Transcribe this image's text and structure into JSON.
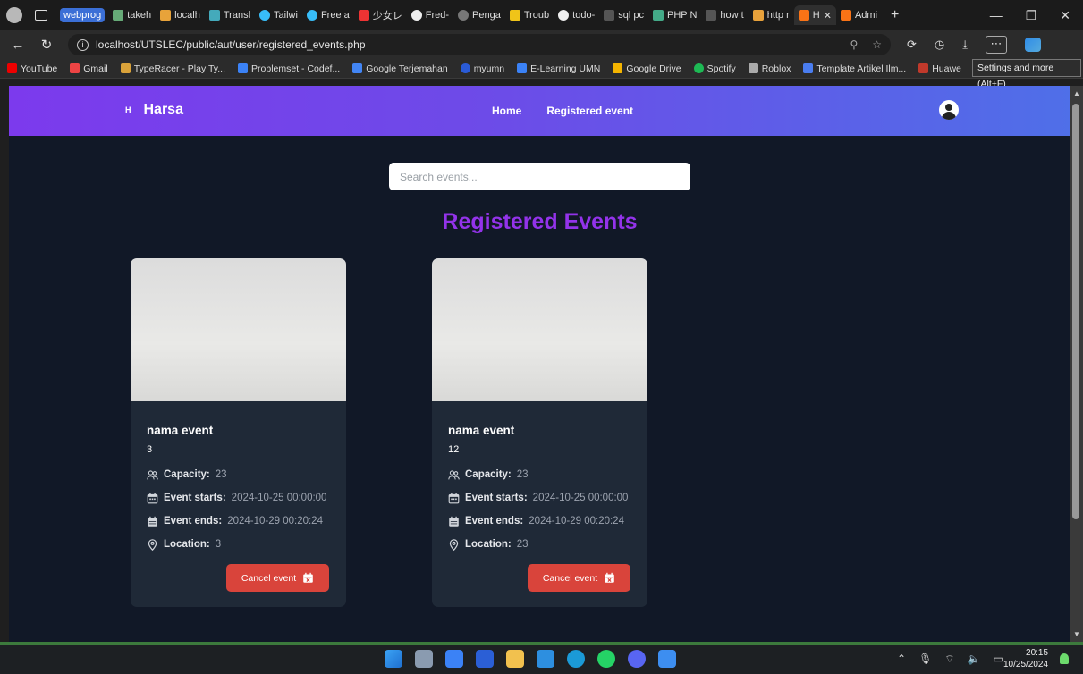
{
  "browser": {
    "tab_group": "webprog",
    "tabs": [
      "takeh",
      "localh",
      "Transl",
      "Tailwi",
      "Free a",
      "少女レ",
      "Fred-",
      "Penga",
      "Troub",
      "todo-",
      "sql pc",
      "PHP N",
      "how t",
      "http r",
      "H",
      "Admi"
    ],
    "url": "localhost/UTSLEC/public/aut/user/registered_events.php",
    "bookmarks": [
      "YouTube",
      "Gmail",
      "TypeRacer - Play Ty...",
      "Problemset - Codef...",
      "Google Terjemahan",
      "myumn",
      "E-Learning UMN",
      "Google Drive",
      "Spotify",
      "Roblox",
      "Template Artikel Ilm...",
      "Huawe"
    ],
    "tooltip": "Settings and more (Alt+F)"
  },
  "site": {
    "logo_mark": "H",
    "brand": "Harsa",
    "nav": [
      "Home",
      "Registered event"
    ],
    "search_placeholder": "Search events...",
    "page_title": "Registered Events",
    "cancel_label": "Cancel event",
    "labels": {
      "capacity": "Capacity:",
      "starts": "Event starts:",
      "ends": "Event ends:",
      "location": "Location:"
    },
    "events": [
      {
        "name": "nama event",
        "id": "3",
        "capacity": "23",
        "starts": "2024-10-25 00:00:00",
        "ends": "2024-10-29 00:20:24",
        "location": "3"
      },
      {
        "name": "nama event",
        "id": "12",
        "capacity": "23",
        "starts": "2024-10-25 00:00:00",
        "ends": "2024-10-29 00:20:24",
        "location": "23"
      }
    ]
  },
  "taskbar": {
    "time": "20:15",
    "date": "10/25/2024"
  },
  "colors": {
    "navbar_start": "#7c3aed",
    "navbar_end": "#4f6fe8",
    "title": "#9333ea",
    "cancel": "#d9443b",
    "page_bg": "#111827",
    "card_bg": "#1f2937"
  }
}
